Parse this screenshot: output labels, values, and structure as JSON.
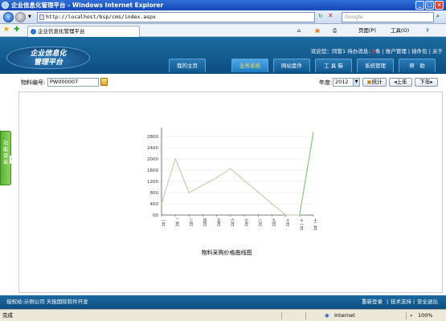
{
  "window": {
    "title": "企业信息化管理平台 - Windows Internet Explorer",
    "minimize_glyph": "_",
    "maximize_glyph": "□",
    "close_glyph": "×"
  },
  "browser": {
    "url": "http://localhost/bsp/cms/index.aspx",
    "search_placeholder": "Google",
    "tab_title": "企业信息化管理平台",
    "tools": {
      "home": "⌂",
      "feeds": "▣",
      "print": "⎙",
      "page_label": "页面(P)",
      "tools_label": "工具(O)",
      "help": "?"
    }
  },
  "app": {
    "logo_lines": [
      "企业信息化",
      "管理平台"
    ],
    "user_info": {
      "prefix": "欢迎您：",
      "user": "同管1",
      "todo_label": "待办消息:",
      "todo_count": "3",
      "todo_unit": "条",
      "links": [
        "账户管理",
        "插件包",
        "关于"
      ]
    },
    "nav": [
      "我的主页",
      "业务系统",
      "网站套件",
      "工 具 箱",
      "系统管理",
      "帮　助"
    ],
    "active_nav": 1
  },
  "toolbar": {
    "code_label": "物料编号:",
    "code_value": "PW000007",
    "year_label": "年度:",
    "year_value": "2012",
    "stats_button": "统计",
    "prev_button": "上年",
    "next_button": "下年"
  },
  "side_tab": {
    "label": "功能菜单"
  },
  "chart_data": {
    "type": "line",
    "title": "物料采购价格曲线图",
    "categories": [
      "一月",
      "二月",
      "三月",
      "四月",
      "五月",
      "六月",
      "七月",
      "八月",
      "九月",
      "十月",
      "十一月",
      "十二月"
    ],
    "series": [
      {
        "values": [
          400,
          2000,
          800,
          1070,
          1330,
          1650,
          1220,
          820,
          400,
          0,
          0,
          2950
        ]
      }
    ],
    "ylim": [
      0,
      3000
    ],
    "yticks": [
      0,
      400,
      800,
      1200,
      1600,
      2000,
      2400,
      2800
    ],
    "ytick_labels": [
      "00",
      "400",
      "800",
      "1200",
      "1600",
      "2000",
      "2400",
      "2800"
    ],
    "grid": true,
    "colors": {
      "line": "#c2c6a2",
      "highlight": "#76ba6e"
    }
  },
  "footer": {
    "left": "授权给:示例公司  天极国际软件开发",
    "links": [
      "重新登录",
      "技术支持",
      "安全退出"
    ]
  },
  "statusbar": {
    "status": "完成",
    "zone": "Internet",
    "zoom": "100%"
  }
}
